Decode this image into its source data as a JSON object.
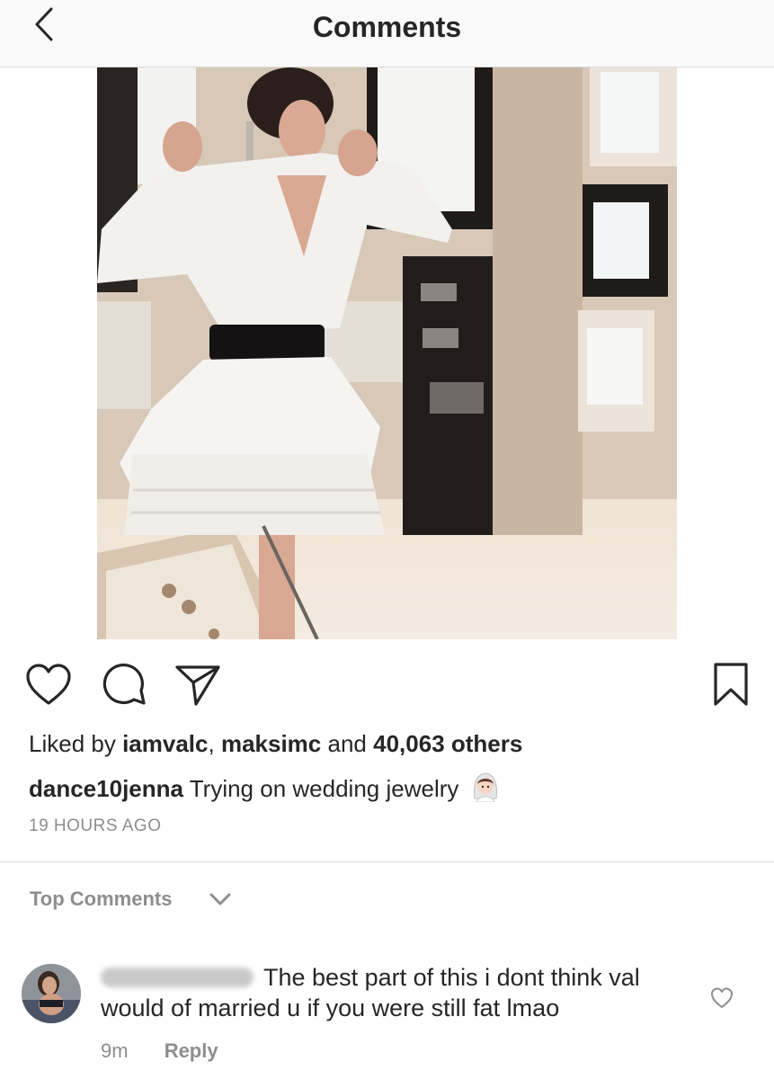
{
  "header": {
    "title": "Comments"
  },
  "post": {
    "likes_prefix": "Liked by",
    "liked_user_1": "iamvalc",
    "liked_sep": ",",
    "liked_user_2": "maksimc",
    "liked_and": "and",
    "liked_others": "40,063 others",
    "caption_user": "dance10jenna",
    "caption_text": "Trying on wedding jewelry",
    "caption_emoji": "bride-emoji",
    "timestamp": "19 HOURS AGO"
  },
  "comments_section": {
    "label": "Top Comments",
    "comment": {
      "text": "The best part of this i dont think val would of married u if you were still fat lmao",
      "time": "9m",
      "reply_label": "Reply"
    }
  },
  "icons": {
    "back": "back-icon",
    "like": "heart-icon",
    "comment": "comment-icon",
    "share": "send-icon",
    "save": "bookmark-icon"
  }
}
